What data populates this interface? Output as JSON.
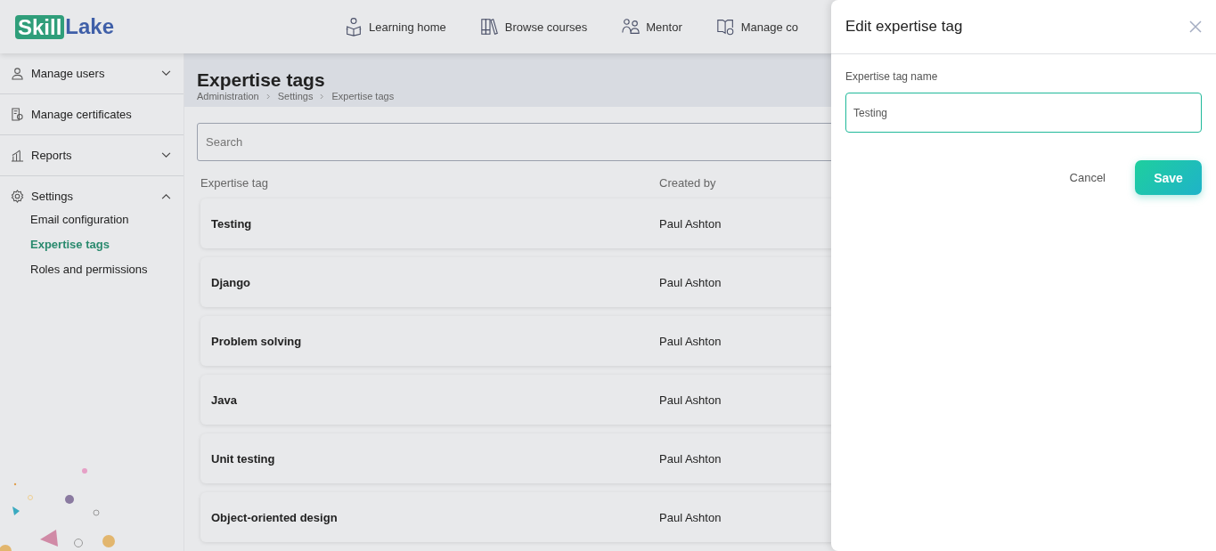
{
  "logo": {
    "part_1": "Skill",
    "part_2": "Lake"
  },
  "top_nav": [
    {
      "label": "Learning home",
      "kind": "reader"
    },
    {
      "label": "Browse courses",
      "kind": "books"
    },
    {
      "label": "Mentor",
      "kind": "people"
    },
    {
      "label": "Manage co",
      "kind": "book-gear"
    }
  ],
  "sidebar": {
    "items": [
      {
        "label": "Manage users",
        "kind": "user",
        "expanded": false
      },
      {
        "label": "Manage certificates",
        "kind": "certificate"
      },
      {
        "label": "Reports",
        "kind": "chart",
        "expanded": false
      },
      {
        "label": "Settings",
        "kind": "gear",
        "expanded": true,
        "children": [
          {
            "label": "Email configuration",
            "selected": false
          },
          {
            "label": "Expertise tags",
            "selected": true
          },
          {
            "label": "Roles and permissions",
            "selected": false
          }
        ]
      }
    ]
  },
  "page": {
    "title": "Expertise tags",
    "breadcrumbs": [
      "Administration",
      "Settings",
      "Expertise tags"
    ]
  },
  "search": {
    "placeholder": "Search"
  },
  "table": {
    "columns": [
      "Expertise tag",
      "Created by"
    ],
    "rows": [
      [
        "Testing",
        "Paul Ashton"
      ],
      [
        "Django",
        "Paul Ashton"
      ],
      [
        "Problem solving",
        "Paul Ashton"
      ],
      [
        "Java",
        "Paul Ashton"
      ],
      [
        "Unit testing",
        "Paul Ashton"
      ],
      [
        "Object-oriented design",
        "Paul Ashton"
      ]
    ]
  },
  "drawer": {
    "title": "Edit expertise tag",
    "field_label": "Expertise tag name",
    "field_value": "Testing",
    "cancel": "Cancel",
    "save": "Save"
  }
}
